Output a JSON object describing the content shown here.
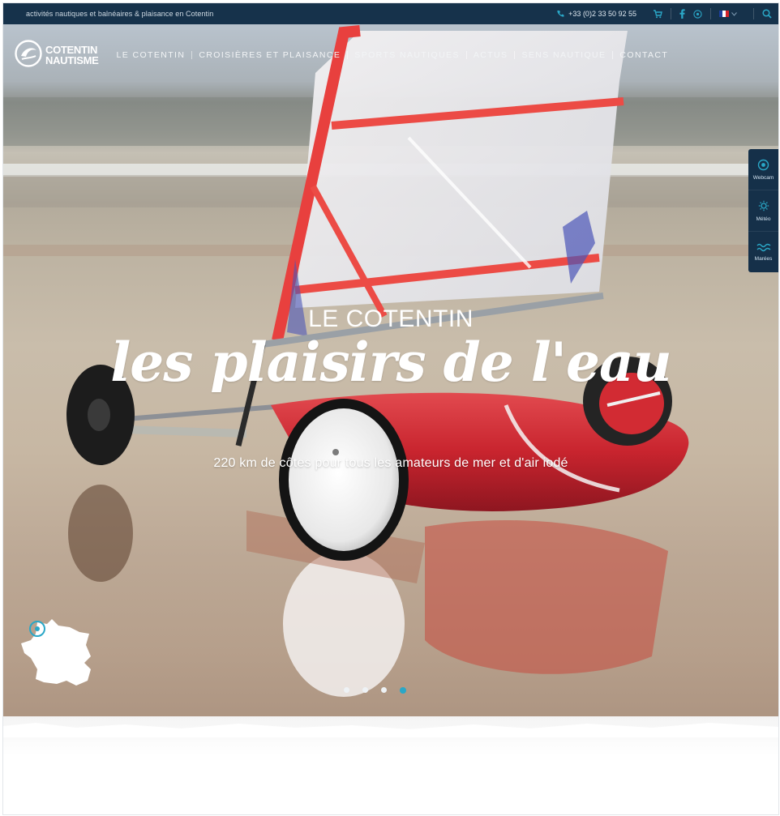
{
  "topbar": {
    "tagline": "activités nautiques et balnéaires & plaisance en Cotentin",
    "phone": "+33 (0)2 33 50 92 55",
    "language": "FR"
  },
  "nav": {
    "logo_line1": "COTENTIN",
    "logo_line2": "NAUTISME",
    "items": [
      {
        "label": "Le Cotentin"
      },
      {
        "label": "Croisières et plaisance"
      },
      {
        "label": "Sports nautiques"
      },
      {
        "label": "Actus"
      },
      {
        "label": "Sens nautique"
      },
      {
        "label": "Contact"
      }
    ]
  },
  "side_tabs": [
    {
      "label": "Webcam",
      "icon": "webcam-icon"
    },
    {
      "label": "Météo",
      "icon": "weather-icon"
    },
    {
      "label": "Marées",
      "icon": "tide-icon"
    }
  ],
  "hero": {
    "eyebrow": "LE COTENTIN",
    "headline": "les plaisirs de l'eau",
    "subline": "220 km de côtes pour tous les amateurs de mer et d'air iodé",
    "slides_total": 4,
    "active_slide": 4
  },
  "colors": {
    "topbar_bg": "#16324b",
    "accent": "#2aa7c7",
    "land_yacht_red": "#c8242e"
  }
}
